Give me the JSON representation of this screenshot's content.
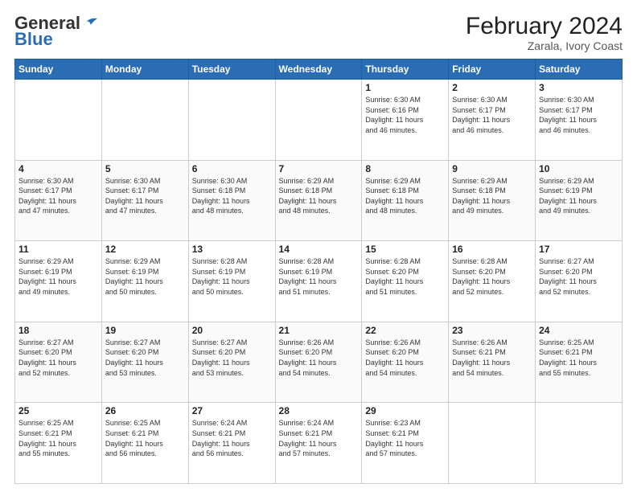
{
  "header": {
    "logo_general": "General",
    "logo_blue": "Blue",
    "title": "February 2024",
    "location": "Zarala, Ivory Coast"
  },
  "days_of_week": [
    "Sunday",
    "Monday",
    "Tuesday",
    "Wednesday",
    "Thursday",
    "Friday",
    "Saturday"
  ],
  "weeks": [
    [
      {
        "day": "",
        "info": ""
      },
      {
        "day": "",
        "info": ""
      },
      {
        "day": "",
        "info": ""
      },
      {
        "day": "",
        "info": ""
      },
      {
        "day": "1",
        "info": "Sunrise: 6:30 AM\nSunset: 6:16 PM\nDaylight: 11 hours\nand 46 minutes."
      },
      {
        "day": "2",
        "info": "Sunrise: 6:30 AM\nSunset: 6:17 PM\nDaylight: 11 hours\nand 46 minutes."
      },
      {
        "day": "3",
        "info": "Sunrise: 6:30 AM\nSunset: 6:17 PM\nDaylight: 11 hours\nand 46 minutes."
      }
    ],
    [
      {
        "day": "4",
        "info": "Sunrise: 6:30 AM\nSunset: 6:17 PM\nDaylight: 11 hours\nand 47 minutes."
      },
      {
        "day": "5",
        "info": "Sunrise: 6:30 AM\nSunset: 6:17 PM\nDaylight: 11 hours\nand 47 minutes."
      },
      {
        "day": "6",
        "info": "Sunrise: 6:30 AM\nSunset: 6:18 PM\nDaylight: 11 hours\nand 48 minutes."
      },
      {
        "day": "7",
        "info": "Sunrise: 6:29 AM\nSunset: 6:18 PM\nDaylight: 11 hours\nand 48 minutes."
      },
      {
        "day": "8",
        "info": "Sunrise: 6:29 AM\nSunset: 6:18 PM\nDaylight: 11 hours\nand 48 minutes."
      },
      {
        "day": "9",
        "info": "Sunrise: 6:29 AM\nSunset: 6:18 PM\nDaylight: 11 hours\nand 49 minutes."
      },
      {
        "day": "10",
        "info": "Sunrise: 6:29 AM\nSunset: 6:19 PM\nDaylight: 11 hours\nand 49 minutes."
      }
    ],
    [
      {
        "day": "11",
        "info": "Sunrise: 6:29 AM\nSunset: 6:19 PM\nDaylight: 11 hours\nand 49 minutes."
      },
      {
        "day": "12",
        "info": "Sunrise: 6:29 AM\nSunset: 6:19 PM\nDaylight: 11 hours\nand 50 minutes."
      },
      {
        "day": "13",
        "info": "Sunrise: 6:28 AM\nSunset: 6:19 PM\nDaylight: 11 hours\nand 50 minutes."
      },
      {
        "day": "14",
        "info": "Sunrise: 6:28 AM\nSunset: 6:19 PM\nDaylight: 11 hours\nand 51 minutes."
      },
      {
        "day": "15",
        "info": "Sunrise: 6:28 AM\nSunset: 6:20 PM\nDaylight: 11 hours\nand 51 minutes."
      },
      {
        "day": "16",
        "info": "Sunrise: 6:28 AM\nSunset: 6:20 PM\nDaylight: 11 hours\nand 52 minutes."
      },
      {
        "day": "17",
        "info": "Sunrise: 6:27 AM\nSunset: 6:20 PM\nDaylight: 11 hours\nand 52 minutes."
      }
    ],
    [
      {
        "day": "18",
        "info": "Sunrise: 6:27 AM\nSunset: 6:20 PM\nDaylight: 11 hours\nand 52 minutes."
      },
      {
        "day": "19",
        "info": "Sunrise: 6:27 AM\nSunset: 6:20 PM\nDaylight: 11 hours\nand 53 minutes."
      },
      {
        "day": "20",
        "info": "Sunrise: 6:27 AM\nSunset: 6:20 PM\nDaylight: 11 hours\nand 53 minutes."
      },
      {
        "day": "21",
        "info": "Sunrise: 6:26 AM\nSunset: 6:20 PM\nDaylight: 11 hours\nand 54 minutes."
      },
      {
        "day": "22",
        "info": "Sunrise: 6:26 AM\nSunset: 6:20 PM\nDaylight: 11 hours\nand 54 minutes."
      },
      {
        "day": "23",
        "info": "Sunrise: 6:26 AM\nSunset: 6:21 PM\nDaylight: 11 hours\nand 54 minutes."
      },
      {
        "day": "24",
        "info": "Sunrise: 6:25 AM\nSunset: 6:21 PM\nDaylight: 11 hours\nand 55 minutes."
      }
    ],
    [
      {
        "day": "25",
        "info": "Sunrise: 6:25 AM\nSunset: 6:21 PM\nDaylight: 11 hours\nand 55 minutes."
      },
      {
        "day": "26",
        "info": "Sunrise: 6:25 AM\nSunset: 6:21 PM\nDaylight: 11 hours\nand 56 minutes."
      },
      {
        "day": "27",
        "info": "Sunrise: 6:24 AM\nSunset: 6:21 PM\nDaylight: 11 hours\nand 56 minutes."
      },
      {
        "day": "28",
        "info": "Sunrise: 6:24 AM\nSunset: 6:21 PM\nDaylight: 11 hours\nand 57 minutes."
      },
      {
        "day": "29",
        "info": "Sunrise: 6:23 AM\nSunset: 6:21 PM\nDaylight: 11 hours\nand 57 minutes."
      },
      {
        "day": "",
        "info": ""
      },
      {
        "day": "",
        "info": ""
      }
    ]
  ]
}
